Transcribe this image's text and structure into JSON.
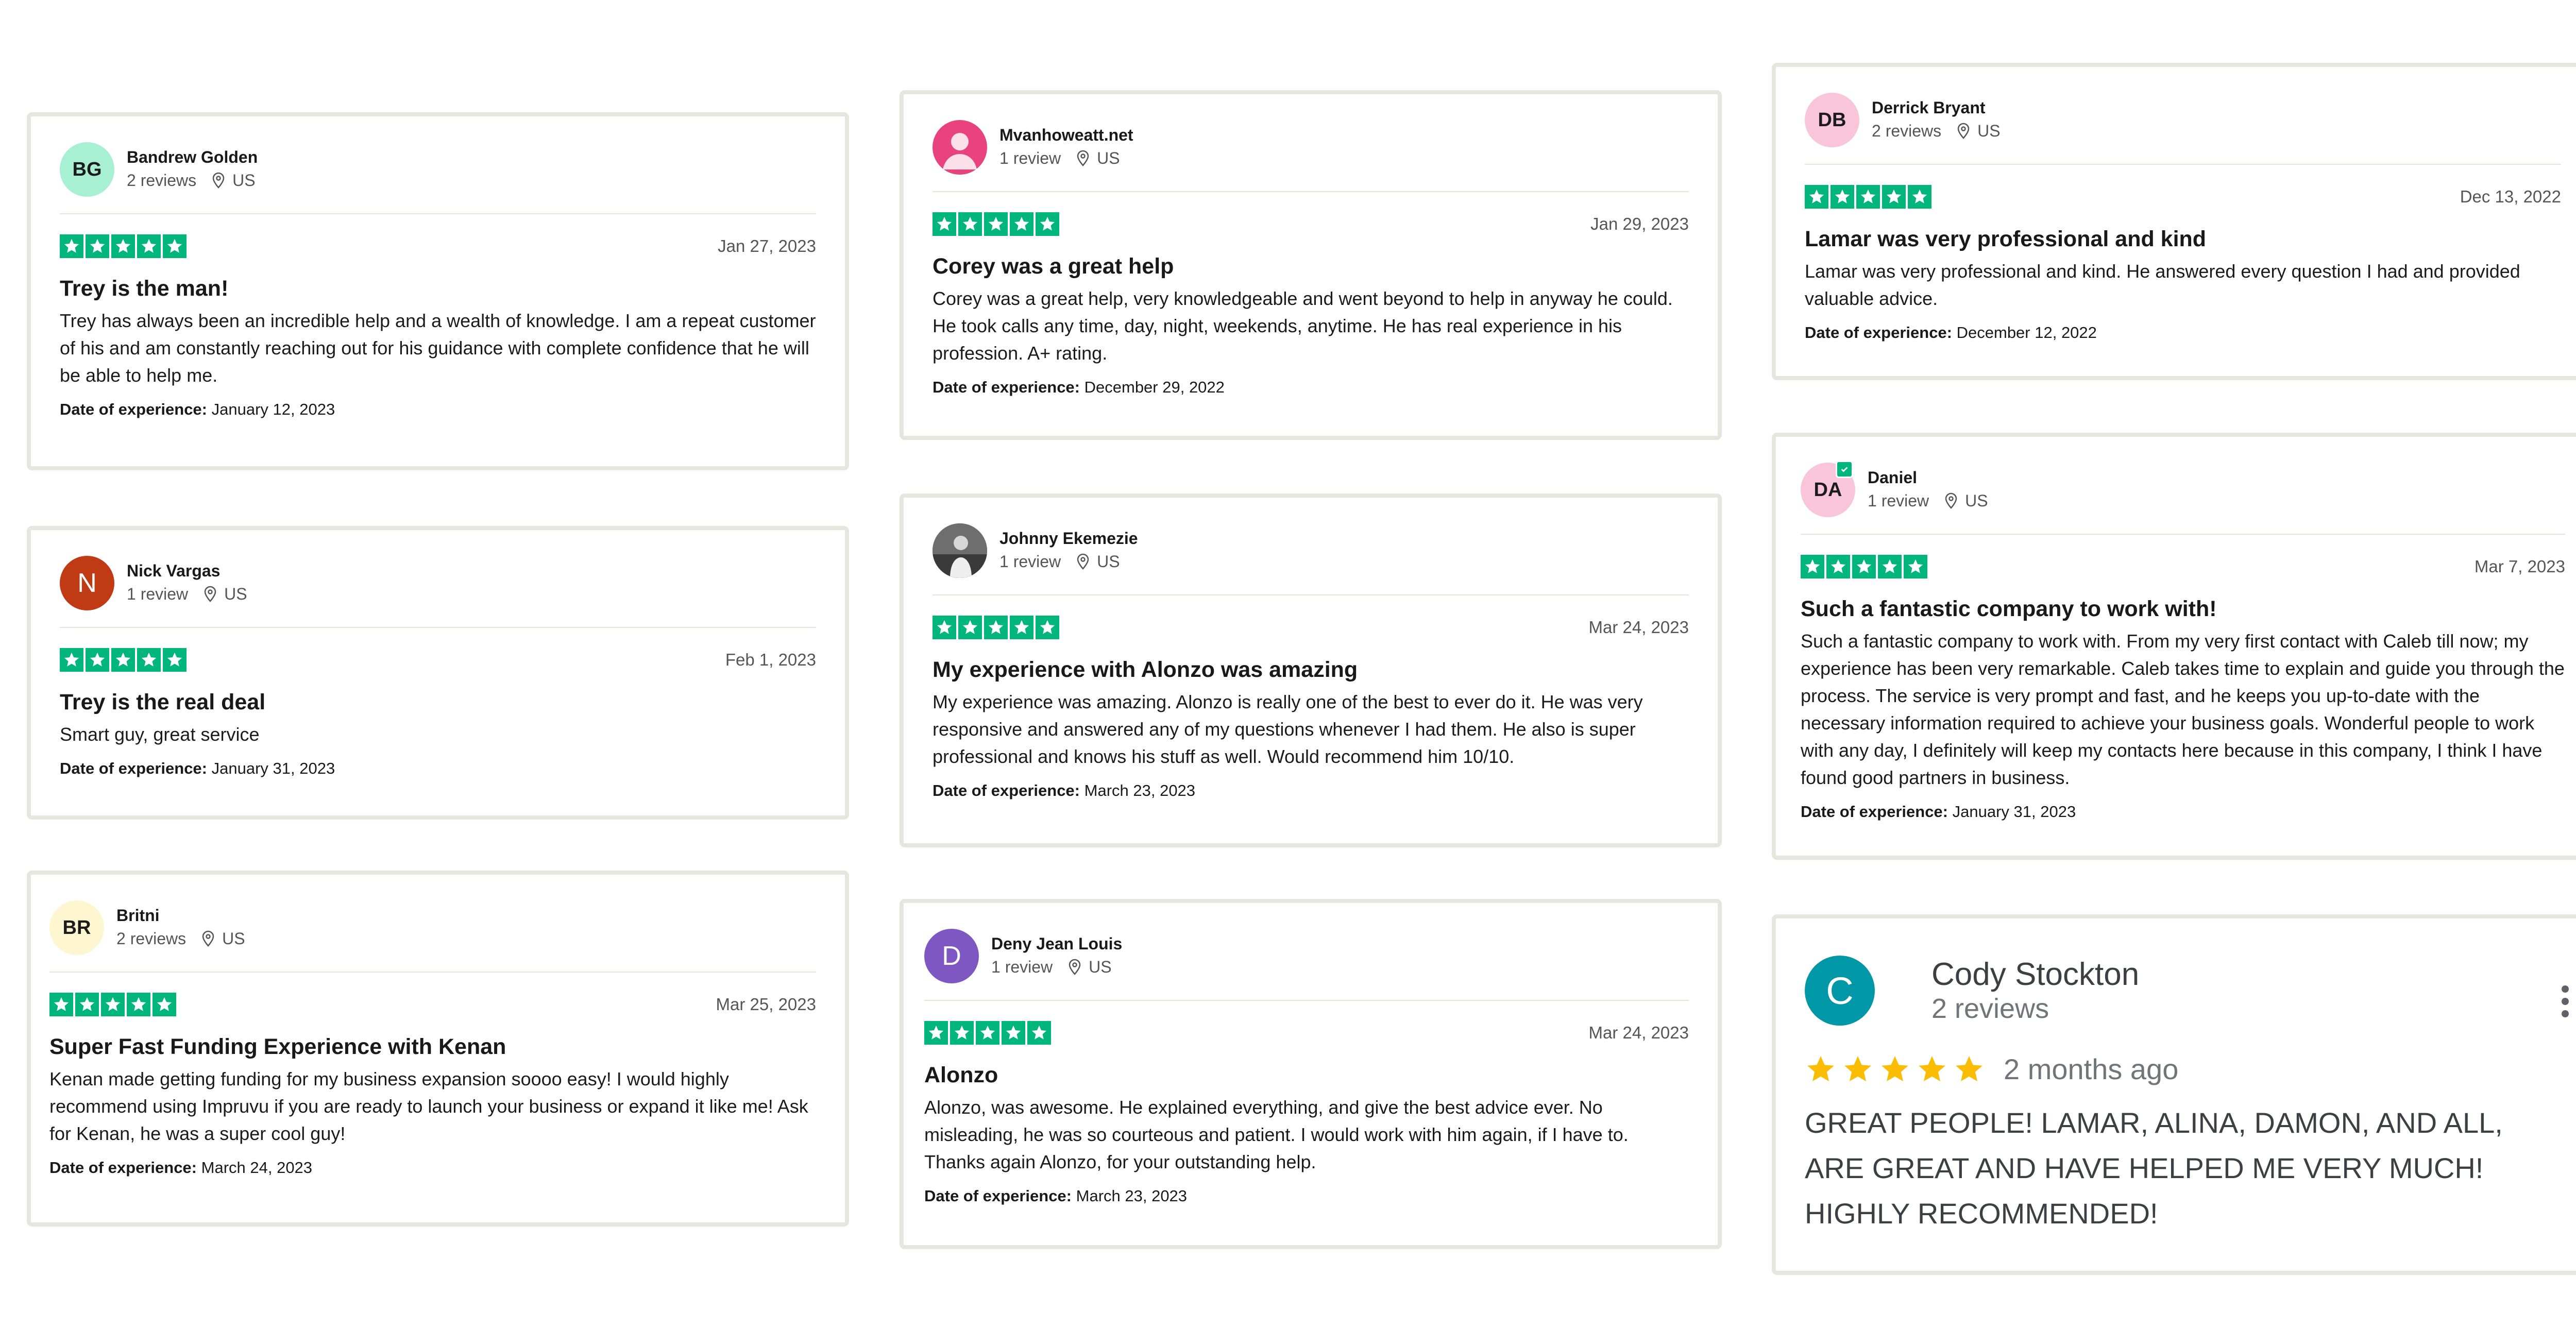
{
  "accent_color": "#00b67a",
  "location_icon": "map-pin-icon",
  "doe_label": "Date of experience:",
  "reviews": [
    {
      "avatar": {
        "initials": "BG",
        "bg": "#a7f0d4"
      },
      "name": "Bandrew Golden",
      "count": "2 reviews",
      "country": "US",
      "rating": 5,
      "date": "Jan 27, 2023",
      "title": "Trey is the man!",
      "body": "Trey has always been an incredible help and a wealth of knowledge. I am a repeat customer of his and am constantly reaching out for his guidance with complete confidence that he will be able to help me.",
      "experience": "January 12, 2023"
    },
    {
      "avatar": {
        "initials": "N",
        "bg": "#c03a14"
      },
      "name": "Nick Vargas",
      "count": "1 review",
      "country": "US",
      "rating": 5,
      "date": "Feb 1, 2023",
      "title": "Trey is the real deal",
      "body": "Smart guy, great service",
      "experience": "January 31, 2023"
    },
    {
      "avatar": {
        "initials": "BR",
        "bg": "#fdf6d0"
      },
      "name": "Britni",
      "count": "2 reviews",
      "country": "US",
      "rating": 5,
      "date": "Mar 25, 2023",
      "title": "Super Fast Funding Experience with Kenan",
      "body": "Kenan made getting funding for my business expansion soooo easy! I would highly recommend using Impruvu if you are ready to launch your business or expand it like me! Ask for Kenan, he was a super cool guy!",
      "experience": "March 24, 2023"
    },
    {
      "avatar": {
        "initials": "",
        "bg": "#e8437d"
      },
      "name": "Mvanhoweatt.net",
      "count": "1 review",
      "country": "US",
      "rating": 5,
      "date": "Jan 29, 2023",
      "title": "Corey was a great help",
      "body": "Corey was a great help, very knowledgeable and went beyond to help in anyway he could. He took calls any time, day, night, weekends, anytime. He has real experience in his profession. A+ rating.",
      "experience": "December 29, 2022"
    },
    {
      "avatar": {
        "initials": "",
        "bg": "#5b5b5b"
      },
      "name": "Johnny Ekemezie",
      "count": "1 review",
      "country": "US",
      "rating": 5,
      "date": "Mar 24, 2023",
      "title": "My experience with Alonzo was amazing",
      "body": "My experience was amazing. Alonzo is really one of the best to ever do it. He was very responsive and answered any of my questions whenever I had them. He also is super professional and knows his stuff as well. Would recommend him 10/10.",
      "experience": "March 23, 2023"
    },
    {
      "avatar": {
        "initials": "D",
        "bg": "#7e57c2"
      },
      "name": "Deny Jean Louis",
      "count": "1 review",
      "country": "US",
      "rating": 5,
      "date": "Mar 24, 2023",
      "title": "Alonzo",
      "body": "Alonzo, was awesome. He explained everything, and give the best advice ever. No misleading, he was so courteous and patient. I would work with him again, if I have to. Thanks again Alonzo, for your outstanding help.",
      "experience": "March 23, 2023"
    },
    {
      "avatar": {
        "initials": "DB",
        "bg": "#f9c6d9"
      },
      "name": "Derrick Bryant",
      "count": "2 reviews",
      "country": "US",
      "rating": 5,
      "date": "Dec 13, 2022",
      "title": "Lamar was very professional and kind",
      "body": "Lamar was very professional and kind. He answered every question I had and provided valuable advice.",
      "experience": "December 12, 2022"
    },
    {
      "avatar": {
        "initials": "DA",
        "bg": "#f9c6d9"
      },
      "name": "Daniel",
      "count": "1 review",
      "country": "US",
      "rating": 5,
      "date": "Mar 7, 2023",
      "title": "Such a fantastic company to work with!",
      "body": "Such a fantastic company to work with. From my very first contact with Caleb till now; my experience has been very remarkable. Caleb takes time to explain and guide you through the process. The service is very prompt and fast, and he keeps you up-to-date with the necessary information required to achieve your business goals. Wonderful people to work with any day, I definitely will keep my contacts here because in this company, I think I have found good partners in business.",
      "experience": "January 31, 2023"
    }
  ],
  "google_review": {
    "initial": "C",
    "avatar_bg": "#0097a7",
    "name": "Cody Stockton",
    "count": "2 reviews",
    "rating": 5,
    "when": "2 months ago",
    "text": "GREAT PEOPLE! LAMAR, ALINA, DAMON, AND ALL, ARE GREAT AND HAVE HELPED ME VERY MUCH! HIGHLY RECOMMENDED!",
    "star_color": "#fbbc04"
  }
}
